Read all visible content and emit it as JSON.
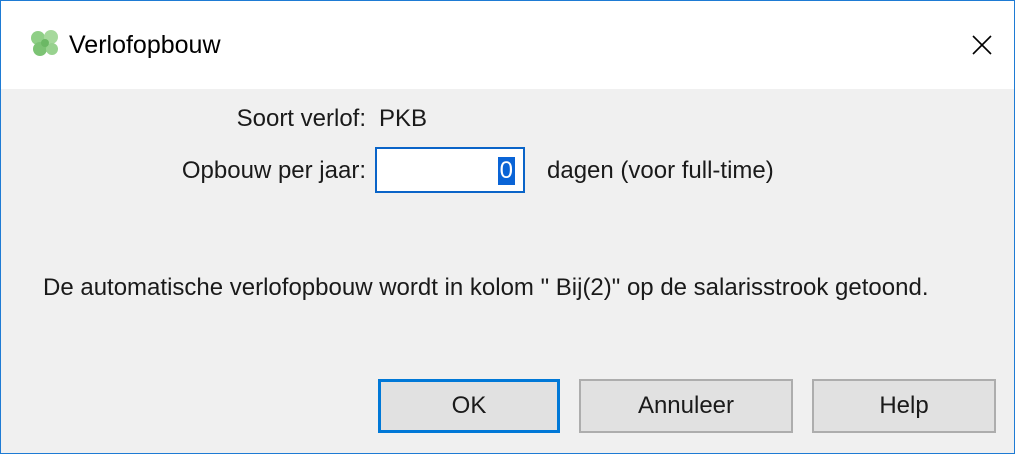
{
  "window": {
    "title": "Verlofopbouw",
    "accent_color": "#1e7bd4"
  },
  "form": {
    "soort_label": "Soort verlof:",
    "soort_value": "PKB",
    "opbouw_label": "Opbouw per jaar:",
    "opbouw_value": "0",
    "opbouw_unit": "dagen (voor full-time)"
  },
  "info": {
    "text": "De automatische verlofopbouw wordt in kolom \" Bij(2)\"  op de salarisstrook getoond."
  },
  "buttons": {
    "ok_label": "OK",
    "cancel_label": "Annuleer",
    "help_label": "Help"
  },
  "icons": {
    "app": "clover-leaf-icon",
    "close": "close-icon"
  }
}
